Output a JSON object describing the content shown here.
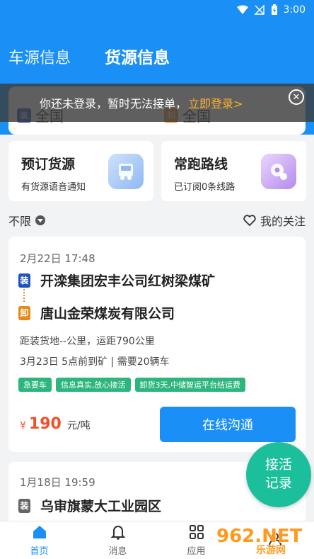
{
  "status_bar": {
    "time": "3:00"
  },
  "header": {
    "tabs": [
      {
        "label": "车源信息",
        "active": false
      },
      {
        "label": "货源信息",
        "active": true
      }
    ]
  },
  "route_filter": {
    "load": {
      "tag": "装",
      "value": "全国"
    },
    "unload": {
      "tag": "卸",
      "value": "全国"
    }
  },
  "login_banner": {
    "text": "你还未登录，暂时无法接单，",
    "link": "立即登录>"
  },
  "features": [
    {
      "title": "预订货源",
      "subtitle": "有货源语音通知",
      "icon": "truck-icon"
    },
    {
      "title": "常跑路线",
      "subtitle": "已订阅0条线路",
      "icon": "route-pin-icon"
    }
  ],
  "filter": {
    "left": "不限",
    "right": "我的关注"
  },
  "cargo_cards": [
    {
      "date": "2月22日 17:48",
      "load_tag": "装",
      "load": "开滦集团宏丰公司红树梁煤矿",
      "unload_tag": "卸",
      "unload": "唐山金荣煤炭有限公司",
      "distance": "距装货地--公里，运距790公里",
      "schedule": "3月23日 5点前到矿 | 需要20辆车",
      "badges": [
        "急要车",
        "信息真实,放心接活",
        "卸货3天,中储智运平台结运费"
      ],
      "price_symbol": "¥",
      "price": "190",
      "price_unit": "元/吨",
      "button": "在线沟通"
    },
    {
      "date": "1月18日 19:59",
      "load_tag": "装",
      "load": "乌审旗蒙大工业园区"
    }
  ],
  "float_button": {
    "line1": "接活",
    "line2": "记录"
  },
  "bottom_nav": [
    {
      "label": "首页",
      "active": true
    },
    {
      "label": "消息",
      "active": false
    },
    {
      "label": "应用",
      "active": false
    },
    {
      "label": "",
      "active": false
    }
  ],
  "watermark": {
    "main": "962.NET",
    "sub": "乐游网"
  },
  "colors": {
    "primary": "#1a8ff6",
    "accent": "#ffb12b",
    "badge": "#2cb67d",
    "price": "#f0502a",
    "float": "#1cbf9c"
  }
}
